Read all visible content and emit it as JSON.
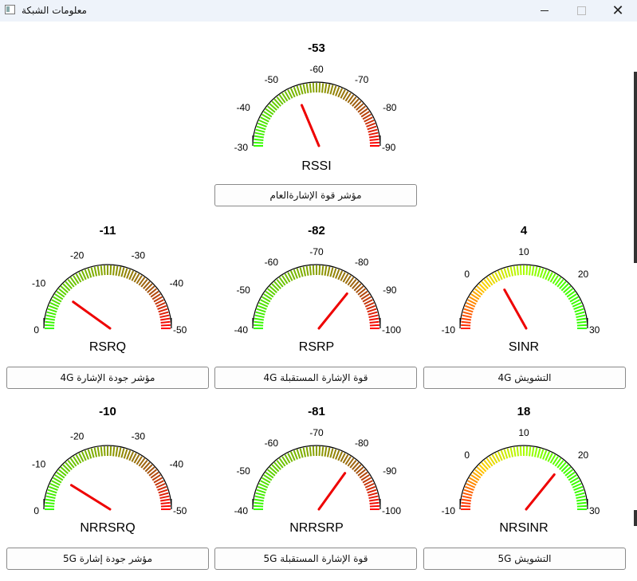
{
  "window": {
    "title": "معلومات الشبكة"
  },
  "gauges": [
    {
      "id": "rssi",
      "value": "-53",
      "name": "RSSI",
      "button": "مؤشر قوة الإشارةالعام",
      "min": -30,
      "max": -90,
      "reading": -53,
      "ticks": [
        "-30",
        "-40",
        "-50",
        "-60",
        "-70",
        "-80",
        "-90"
      ],
      "colors": [
        "#33ff00",
        "#66cc00",
        "#8aa000",
        "#a05a10",
        "#ff0000"
      ]
    },
    {
      "id": "rsrq",
      "value": "-11",
      "name": "RSRQ",
      "button": "مؤشر جودة الإشارة 4G",
      "min": 0,
      "max": -50,
      "reading": -11,
      "ticks": [
        "0",
        "-10",
        "-20",
        "-30",
        "-40",
        "-50"
      ],
      "colors": [
        "#33ff00",
        "#66cc00",
        "#8aa000",
        "#a05a10",
        "#ff0000"
      ]
    },
    {
      "id": "rsrp",
      "value": "-82",
      "name": "RSRP",
      "button": "قوة الإشارة المستقبلة 4G",
      "min": -40,
      "max": -100,
      "reading": -82,
      "ticks": [
        "-40",
        "-50",
        "-60",
        "-70",
        "-80",
        "-90",
        "-100"
      ],
      "colors": [
        "#33ff00",
        "#66cc00",
        "#8aa000",
        "#a05a10",
        "#ff0000"
      ]
    },
    {
      "id": "sinr",
      "value": "4",
      "name": "SINR",
      "button": "التشويش  4G",
      "min": -10,
      "max": 30,
      "reading": 4,
      "ticks": [
        "-10",
        "0",
        "10",
        "20",
        "30"
      ],
      "colors": [
        "#ff2200",
        "#ffcc00",
        "#aaff00",
        "#44ff00",
        "#33ff00"
      ]
    },
    {
      "id": "nrrsrq",
      "value": "-10",
      "name": "NRRSRQ",
      "button": "مؤشر جودة إشارة 5G",
      "min": 0,
      "max": -50,
      "reading": -10,
      "ticks": [
        "0",
        "-10",
        "-20",
        "-30",
        "-40",
        "-50"
      ],
      "colors": [
        "#33ff00",
        "#66cc00",
        "#8aa000",
        "#a05a10",
        "#ff0000"
      ]
    },
    {
      "id": "nrrsrp",
      "value": "-81",
      "name": "NRRSRP",
      "button": "قوة الإشارة المستقبلة 5G",
      "min": -40,
      "max": -100,
      "reading": -81,
      "ticks": [
        "-40",
        "-50",
        "-60",
        "-70",
        "-80",
        "-90",
        "-100"
      ],
      "colors": [
        "#33ff00",
        "#66cc00",
        "#8aa000",
        "#a05a10",
        "#ff0000"
      ]
    },
    {
      "id": "nrsinr",
      "value": "18",
      "name": "NRSINR",
      "button": "التشويش  5G",
      "min": -10,
      "max": 30,
      "reading": 18,
      "ticks": [
        "-10",
        "0",
        "10",
        "20",
        "30"
      ],
      "colors": [
        "#ff2200",
        "#ffcc00",
        "#aaff00",
        "#44ff00",
        "#33ff00"
      ]
    }
  ],
  "needle_color": "#ee0000"
}
